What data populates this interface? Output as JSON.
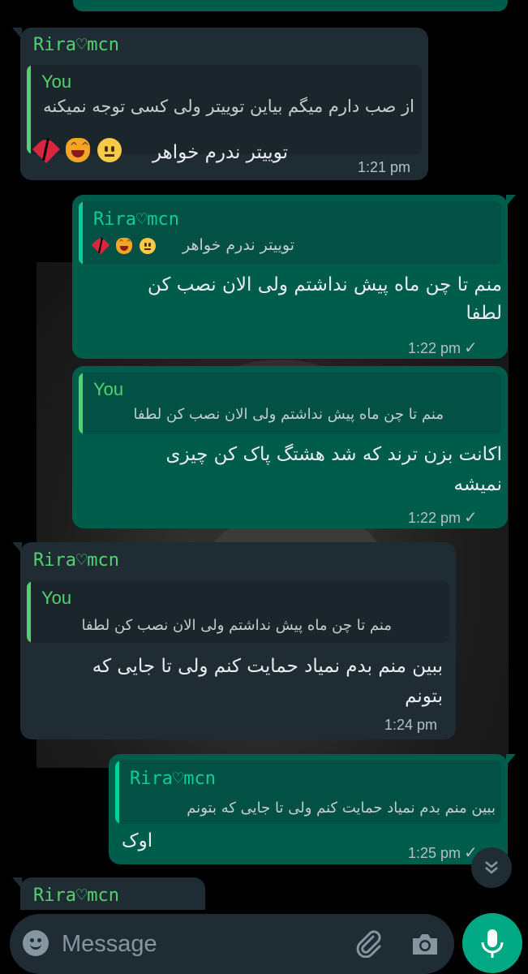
{
  "messages": [
    {
      "sender": "Rira♡mcn",
      "quote": {
        "author": "You",
        "text": "از صب دارم میگم بیاین توییتر ولی کسی توجه نمیکنه"
      },
      "text": "توییتر ندرم خواهر",
      "emojis": [
        "neutral-face",
        "cat-tears-of-joy",
        "broken-heart"
      ],
      "time": "1:21 pm"
    },
    {
      "quote": {
        "author": "Rira♡mcn",
        "text": "توییتر ندرم خواهر",
        "emojis": [
          "neutral-face",
          "cat-tears-of-joy",
          "broken-heart"
        ]
      },
      "text_line1": "منم تا چن ماه پیش نداشتم ولی الان نصب کن",
      "text_line2": "لطفا",
      "time": "1:22 pm",
      "status": "✓"
    },
    {
      "quote": {
        "author": "You",
        "text": "منم تا چن ماه پیش نداشتم ولی الان نصب کن لطفا"
      },
      "text_line1": "اکانت بزن ترند  که  شد هشتگ پاک کن چیزی",
      "text_line2": "نمیشه",
      "time": "1:22 pm",
      "status": "✓"
    },
    {
      "sender": "Rira♡mcn",
      "quote": {
        "author": "You",
        "text": "منم تا چن ماه پیش نداشتم ولی الان نصب کن لطفا"
      },
      "text_line1": "ببین منم بدم نمیاد حمایت کنم ولی تا جایی که",
      "text_line2": "بتونم",
      "time": "1:24 pm"
    },
    {
      "quote": {
        "author": "Rira♡mcn",
        "text": "ببین منم بدم نمیاد حمایت کنم ولی تا جایی که بتونم"
      },
      "text": "اوک",
      "time": "1:25 pm",
      "status": "✓"
    },
    {
      "sender": "Rira♡mcn"
    }
  ],
  "composer": {
    "placeholder": "Message",
    "icons": [
      "emoji-icon",
      "attach-icon",
      "camera-icon",
      "mic-icon"
    ]
  },
  "scroll_button_icon": "double-chevron-down-icon",
  "colors": {
    "incoming_bubble": "#1f2c34",
    "outgoing_bubble": "#005c4b",
    "sender_name": "#53d36f",
    "quote_you_bar": "#53d36f",
    "quote_other_bar": "#06cf9c",
    "send_button": "#00a884"
  }
}
